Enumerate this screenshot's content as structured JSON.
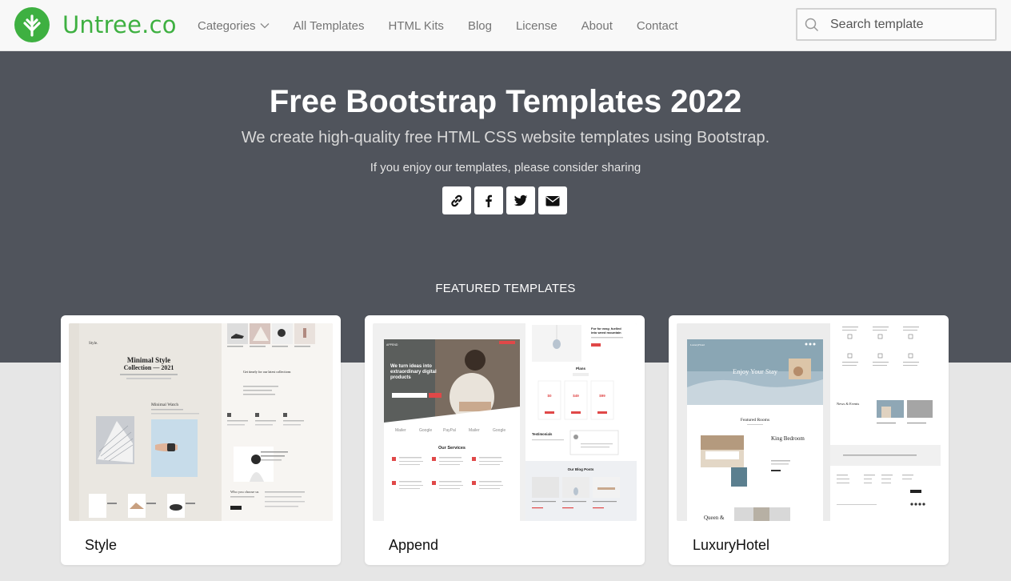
{
  "brand": {
    "name": "Untree.co",
    "color": "#3eb041"
  },
  "nav": {
    "items": [
      {
        "label": "Categories",
        "dropdown": true
      },
      {
        "label": "All Templates"
      },
      {
        "label": "HTML Kits"
      },
      {
        "label": "Blog"
      },
      {
        "label": "License"
      },
      {
        "label": "About"
      },
      {
        "label": "Contact"
      }
    ]
  },
  "search": {
    "placeholder": "Search template",
    "value": ""
  },
  "hero": {
    "title": "Free Bootstrap Templates 2022",
    "subtitle": "We create high-quality free HTML CSS website templates using Bootstrap.",
    "share_text": "If you enjoy our templates, please consider sharing",
    "share_icons": [
      "link-icon",
      "facebook-icon",
      "twitter-icon",
      "envelope-icon"
    ],
    "background": "#50545c"
  },
  "featured": {
    "heading": "FEATURED TEMPLATES",
    "cards": [
      {
        "name": "Style",
        "preview": {
          "title_line1": "Minimal Style",
          "title_line2": "Collection — 2021",
          "product": "Minimal Watch",
          "section": "Get timely for our latest collections",
          "footer": "Who you choose us"
        }
      },
      {
        "name": "Append",
        "preview": {
          "hero": "We turn ideas into extraordinary digital products",
          "services": "Our Services",
          "pricing": "Plans",
          "blog": "Our Blog Posts",
          "testimonials": "Testimonials",
          "brands": [
            "Mailer",
            "Google",
            "PayPal",
            "Mailer",
            "Google"
          ]
        }
      },
      {
        "name": "LuxuryHotel",
        "preview": {
          "hero": "Enjoy Your Stay",
          "featured": "Featured Rooms",
          "room1": "King Bedroom",
          "room2": "Queen &",
          "news": "News & Events"
        }
      }
    ]
  }
}
